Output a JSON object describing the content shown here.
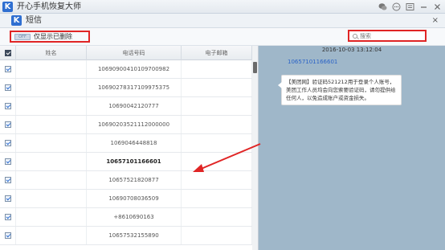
{
  "window": {
    "logo_letter": "K",
    "title": "开心手机恢复大师",
    "controls": [
      "wechat-icon",
      "feedback-icon",
      "menu-icon",
      "minimize-icon",
      "close-icon"
    ]
  },
  "panel": {
    "logo_letter": "K",
    "title": "短信",
    "close_label": "×"
  },
  "toolbar": {
    "toggle_text": "OFF",
    "filter_label": "仅显示已删除",
    "search_placeholder": "搜索"
  },
  "table": {
    "headers": [
      "姓名",
      "电话号码",
      "电子邮箱"
    ],
    "rows": [
      {
        "name": "",
        "phone": "1069090041010970098​2",
        "email": "",
        "selected": false
      },
      {
        "name": "",
        "phone": "10690278317109975375",
        "email": "",
        "selected": false
      },
      {
        "name": "",
        "phone": "1069004212077​7",
        "email": "",
        "selected": false
      },
      {
        "name": "",
        "phone": "10690203521112000000",
        "email": "",
        "selected": false
      },
      {
        "name": "",
        "phone": "1069046448818",
        "email": "",
        "selected": false
      },
      {
        "name": "",
        "phone": "10657101166601",
        "email": "",
        "selected": true
      },
      {
        "name": "",
        "phone": "10657521820877",
        "email": "",
        "selected": false
      },
      {
        "name": "",
        "phone": "1069070803650​9",
        "email": "",
        "selected": false
      },
      {
        "name": "",
        "phone": "+8610690163",
        "email": "",
        "selected": false
      },
      {
        "name": "",
        "phone": "10657532155890",
        "email": "",
        "selected": false
      }
    ]
  },
  "message": {
    "date": "2016-10-03 13:12:04",
    "sender": "10657101166601",
    "body": "【美团网】验证码521212用于登录个人账号，美团工作人员均会向您索要验证码，请勿提供给任何人，以免造成账户或资金损失。"
  },
  "colors": {
    "accent": "#2f6fd1",
    "highlight_border": "#e02525",
    "message_pane_bg": "#9fb7c9"
  }
}
